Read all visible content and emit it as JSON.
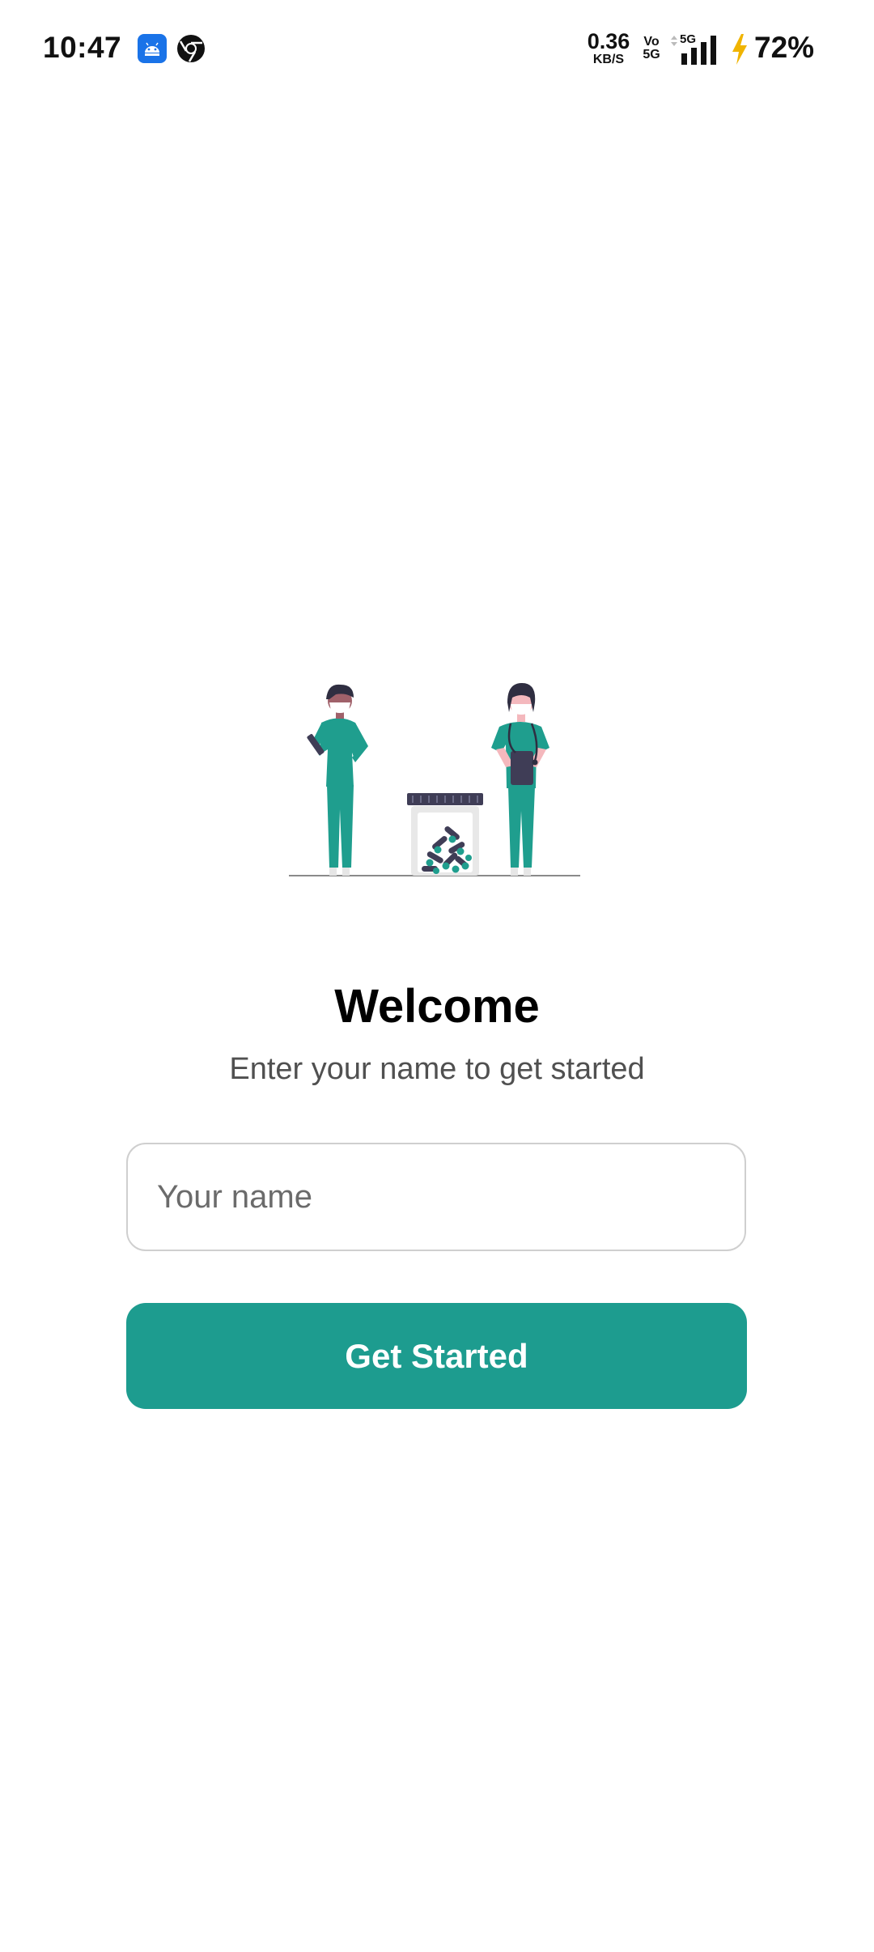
{
  "status_bar": {
    "time": "10:47",
    "net_speed_value": "0.36",
    "net_speed_unit": "KB/S",
    "vo_top": "Vo",
    "vo_bottom": "5G",
    "network_type": "5G",
    "battery": "72%",
    "icons": [
      "android-notification-icon",
      "chrome-icon",
      "signal-icon",
      "charging-bolt-icon"
    ]
  },
  "welcome": {
    "title": "Welcome",
    "subtitle": "Enter your name to get started"
  },
  "name_input": {
    "placeholder": "Your name",
    "value": ""
  },
  "cta": {
    "label": "Get Started"
  },
  "colors": {
    "accent": "#1d9c8f",
    "illustration_teal": "#1f9e8e",
    "illustration_dark": "#3f3d56"
  }
}
